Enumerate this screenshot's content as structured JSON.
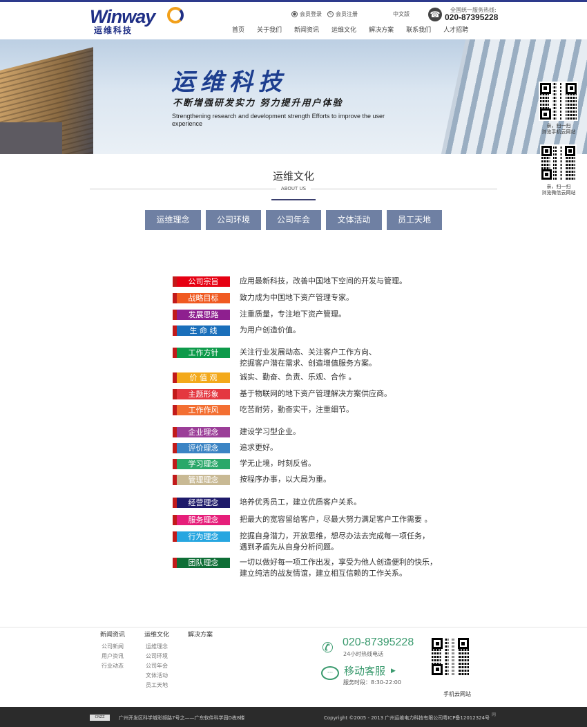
{
  "header": {
    "logo_text": "Winway",
    "logo_cn": "运维科技",
    "member_login": "会员登录",
    "member_register": "会员注册",
    "language": "中文版",
    "hotline_label": "全国统一服务热线:",
    "hotline_number": "020-87395228",
    "nav": [
      "首页",
      "关于我们",
      "新闻资讯",
      "运维文化",
      "解决方案",
      "联系我们",
      "人才招聘"
    ]
  },
  "banner": {
    "title_cn": "运维科技",
    "subtitle_cn": "不断增强研发实力 努力提升用户体验",
    "subtitle_en": "Strengthening research and development strength Efforts to improve the user experience"
  },
  "side_qr": [
    {
      "caption_1": "亲，扫一扫",
      "caption_2": "浏览手机云网站"
    },
    {
      "caption_1": "亲，扫一扫",
      "caption_2": "浏览微信云网站"
    }
  ],
  "section": {
    "title": "运维文化",
    "subtitle_en": "ABOUT US",
    "tabs": [
      "运维理念",
      "公司环境",
      "公司年会",
      "文体活动",
      "员工天地"
    ]
  },
  "values": [
    {
      "tag": "公司宗旨",
      "color": "#e60012",
      "lines": [
        "应用最新科技，改善中国地下空间的开发与管理。"
      ]
    },
    {
      "tag": "战略目标",
      "color": "#f05a22",
      "lines": [
        "致力成为中国地下资产管理专家。"
      ]
    },
    {
      "tag": "发展思路",
      "color": "#8e1f8f",
      "lines": [
        "注重质量，专注地下资产管理。"
      ]
    },
    {
      "tag": "生 命 线",
      "color": "#1a6fba",
      "lines": [
        "为用户创造价值。"
      ]
    },
    {
      "tag": "工作方针",
      "color": "#0d9a4a",
      "lines": [
        "关注行业发展动态、关注客户工作方向、",
        "挖掘客户潜在需求、创造增值服务方案。"
      ]
    },
    {
      "tag": "价 值 观",
      "color": "#f3a91b",
      "lines": [
        "诚实、勤奋、负责、乐观、合作 。"
      ]
    },
    {
      "tag": "主题形象",
      "color": "#e43740",
      "lines": [
        "基于物联网的地下资产管理解决方案供应商。"
      ]
    },
    {
      "tag": "工作作风",
      "color": "#f36f32",
      "lines": [
        "吃苦耐劳，勤奋实干，注重细节。"
      ]
    },
    {
      "tag": "企业理念",
      "color": "#9b3e98",
      "lines": [
        "建设学习型企业。"
      ]
    },
    {
      "tag": "评价理念",
      "color": "#3b84c4",
      "lines": [
        "追求更好。"
      ]
    },
    {
      "tag": "学习理念",
      "color": "#2aa86a",
      "lines": [
        "学无止境，时刻反省。"
      ]
    },
    {
      "tag": "管理理念",
      "color": "#c8b994",
      "lines": [
        "按程序办事，以大局为重。"
      ]
    },
    {
      "tag": "经营理念",
      "color": "#1e1a6a",
      "lines": [
        "培养优秀员工，建立优质客户关系。"
      ]
    },
    {
      "tag": "服务理念",
      "color": "#e61e7a",
      "lines": [
        "把最大的宽容留给客户，尽最大努力满足客户工作需要 。"
      ]
    },
    {
      "tag": "行为理念",
      "color": "#27a6e0",
      "lines": [
        "挖掘自身潜力，开放思维，想尽办法去完成每一项任务，",
        "遇到矛盾先从自身分析问题。"
      ]
    },
    {
      "tag": "团队理念",
      "color": "#0e6e36",
      "lines": [
        "一切以做好每一项工作出发，享受为他人创造便利的快乐，",
        "建立纯洁的战友情谊，建立相互信赖的工作关系。"
      ]
    }
  ],
  "footer": {
    "columns": [
      {
        "title": "新闻资讯",
        "items": [
          "公司新闻",
          "用户资讯",
          "行业动态"
        ]
      },
      {
        "title": "运维文化",
        "items": [
          "运维理念",
          "公司环境",
          "公司年会",
          "文体活动",
          "员工天地"
        ]
      },
      {
        "title": "解决方案",
        "items": []
      }
    ],
    "phone": "020-87395228",
    "phone_note": "24小时热线电话",
    "mobile_service": "移动客服",
    "service_hours": "服务时段：8:30-22:00",
    "qr_caption": "手机云网站",
    "cnzz": "CNZZ",
    "address": "广州开发区科学城彩频路7号之——广东软件科学园D栋8楼",
    "copyright": "Copyright ©2005 - 2013 广州运维电力科技有限公司粤ICP备12012324号",
    "wang": "网"
  },
  "colors": {
    "nav_tab": "#6f80a3",
    "brand": "#1f2f86",
    "footer_green": "#3a9a6e",
    "bottom_bar": "#2b2b2b"
  }
}
